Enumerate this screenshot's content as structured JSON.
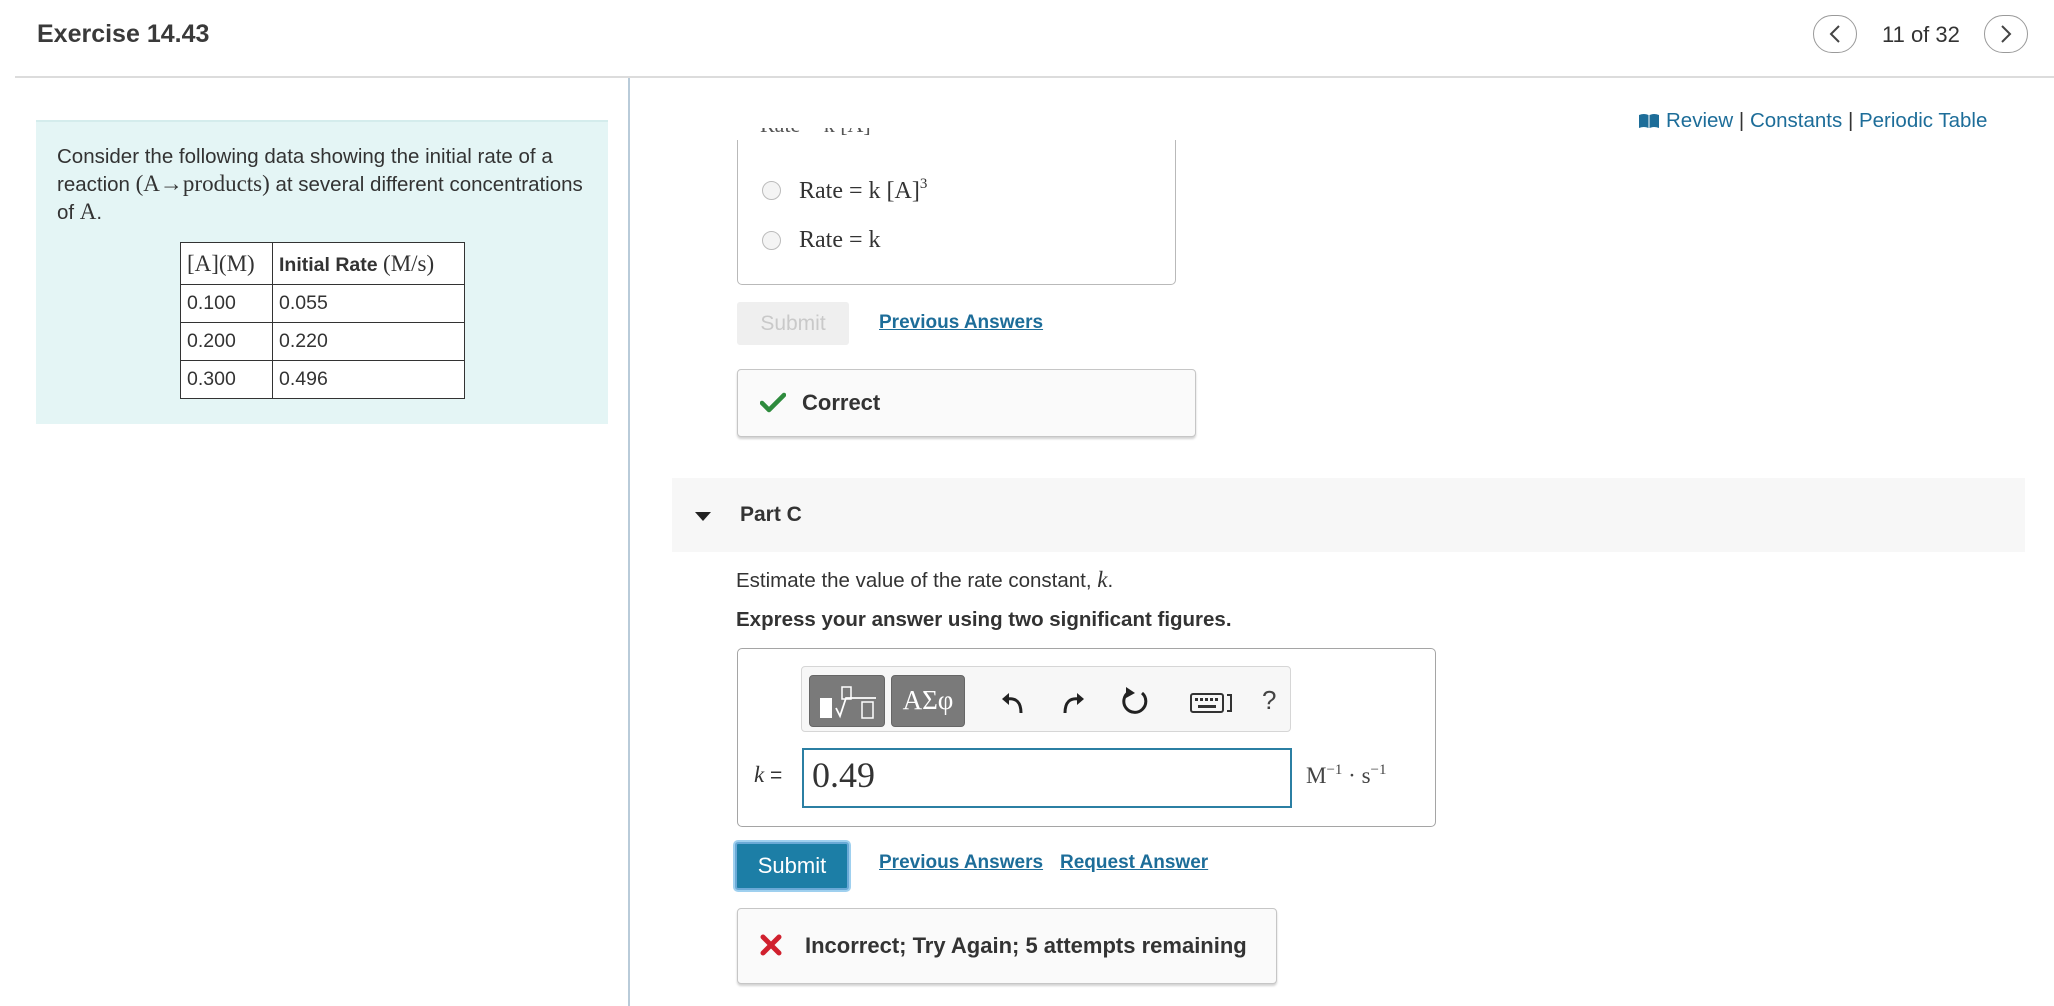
{
  "header": {
    "title": "Exercise 14.43",
    "nav_count": "11 of 32"
  },
  "left": {
    "intro_1": "Consider the following data showing the initial rate of a reaction ",
    "intro_math": "(A→products)",
    "intro_2": " at several different concentrations of ",
    "intro_A": "A",
    "intro_3": ".",
    "table": {
      "header_col1": "[A](M)",
      "header_col2_text": "Initial Rate ",
      "header_col2_unit": "(M/s)",
      "rows": [
        [
          "0.100",
          "0.055"
        ],
        [
          "0.200",
          "0.220"
        ],
        [
          "0.300",
          "0.496"
        ]
      ]
    }
  },
  "top_links": {
    "review": "Review",
    "sep1": " | ",
    "constants": "Constants",
    "sep2": " | ",
    "periodic_table": "Periodic Table"
  },
  "part_b": {
    "partial_option": "Rate = k [A]",
    "options": [
      {
        "base": "Rate = k [A]",
        "sup": "3"
      },
      {
        "base": "Rate = k",
        "sup": ""
      }
    ],
    "submit_label": "Submit",
    "previous_answers": "Previous Answers",
    "feedback": "Correct"
  },
  "part_c": {
    "title": "Part C",
    "question_text": "Estimate the value of the rate constant, ",
    "question_var": "k",
    "question_end": ".",
    "instruction": "Express your answer using two significant figures.",
    "toolbar": {
      "greek_label": "ΑΣφ",
      "help_label": "?"
    },
    "k_var": "k",
    "k_eq": " =",
    "answer_value": "0.49",
    "units": {
      "m": "M",
      "m_exp": "−1",
      "dot": " · ",
      "s": "s",
      "s_exp": "−1"
    },
    "submit_label": "Submit",
    "previous_answers": "Previous Answers",
    "request_answer": "Request Answer",
    "feedback": "Incorrect; Try Again; 5 attempts remaining"
  },
  "colors": {
    "accent": "#1c7ea6",
    "link": "#1d6d99",
    "correct": "#2e8b3d",
    "incorrect": "#d0202e",
    "panel_bg": "#e4f5f5"
  }
}
